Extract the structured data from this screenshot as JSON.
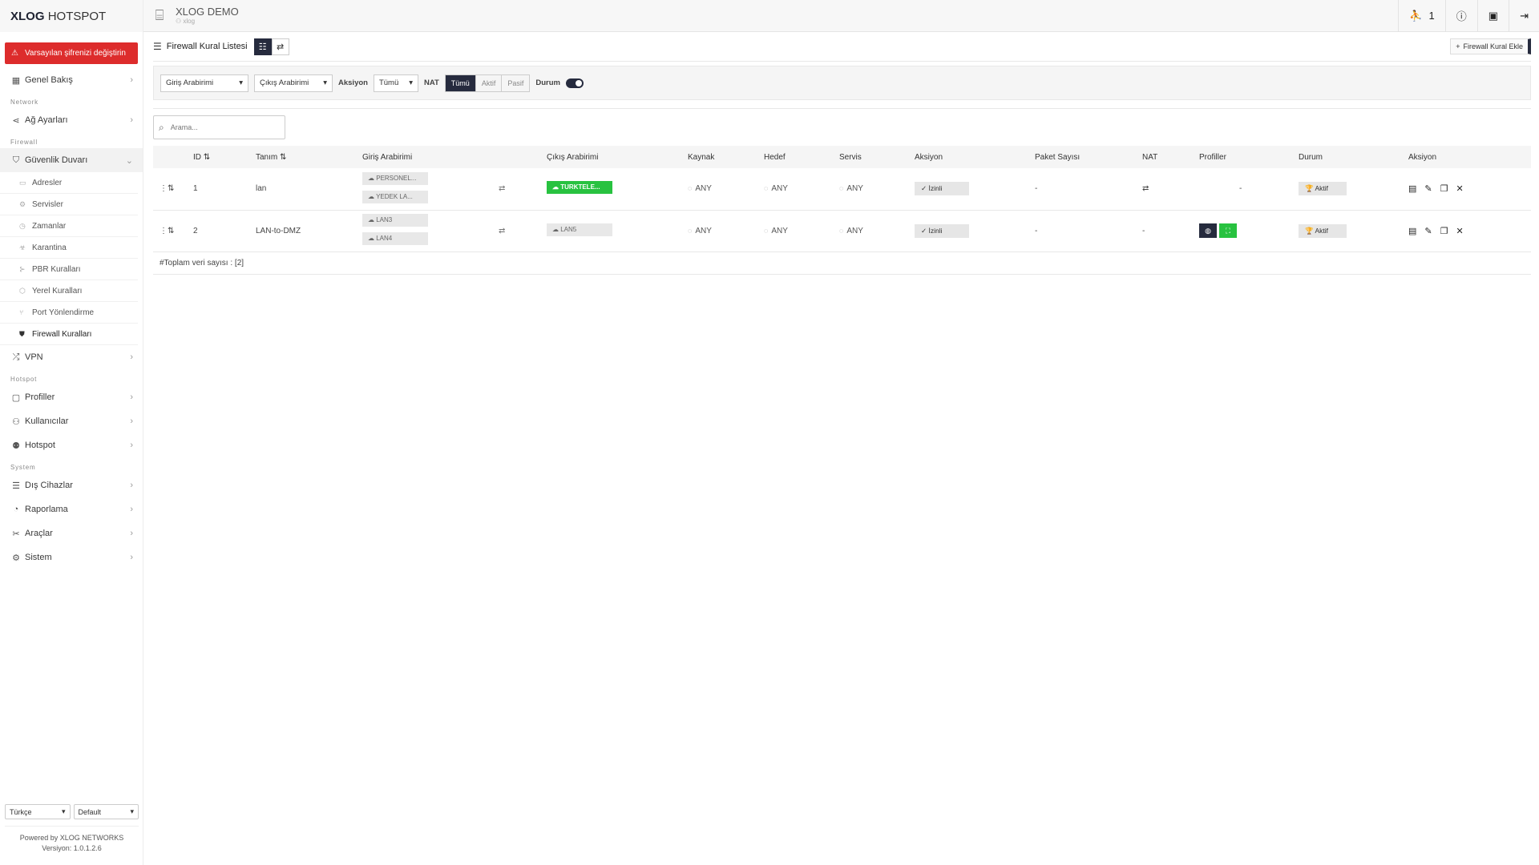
{
  "brand": {
    "bold": "XLOG",
    "light": "HOTSPOT"
  },
  "alert_text": "Varsayılan şifrenizi değiştirin",
  "menu": {
    "overview": "Genel Bakış",
    "network_section": "Network",
    "network": "Ağ Ayarları",
    "firewall_section": "Firewall",
    "security": "Güvenlik Duvarı",
    "sub": [
      "Adresler",
      "Servisler",
      "Zamanlar",
      "Karantina",
      "PBR Kuralları",
      "Yerel Kuralları",
      "Port Yönlendirme",
      "Firewall Kuralları"
    ],
    "vpn": "VPN",
    "hotspot_section": "Hotspot",
    "profiles": "Profiller",
    "users": "Kullanıcılar",
    "hotspot": "Hotspot",
    "system_section": "System",
    "devices": "Dış Cihazlar",
    "reports": "Raporlama",
    "tools": "Araçlar",
    "system": "Sistem"
  },
  "footer": {
    "language": "Türkçe",
    "theme": "Default",
    "powered": "Powered by XLOG NETWORKS",
    "version": "Versiyon: 1.0.1.2.6"
  },
  "topbar": {
    "title": "XLOG DEMO",
    "subtitle": "xlog",
    "online_count": "1"
  },
  "page": {
    "title": "Firewall Kural Listesi",
    "add_label": "Firewall Kural Ekle"
  },
  "filters": {
    "in_iface": "Giriş Arabirimi",
    "out_iface": "Çıkış Arabirimi",
    "action_label": "Aksiyon",
    "action_value": "Tümü",
    "nat_label": "NAT",
    "nat_options": [
      "Tümü",
      "Aktif",
      "Pasif"
    ],
    "status_label": "Durum"
  },
  "search": {
    "placeholder": "Arama..."
  },
  "table": {
    "headers": [
      "ID",
      "Tanım",
      "Giriş Arabirimi",
      "Çıkış Arabirimi",
      "Kaynak",
      "Hedef",
      "Servis",
      "Aksiyon",
      "Paket Sayısı",
      "NAT",
      "Profiller",
      "Durum",
      "Aksiyon"
    ],
    "rows": [
      {
        "id": "1",
        "name": "lan",
        "in": [
          "PERSONEL...",
          "YEDEK LA..."
        ],
        "out": "TURKTELE...",
        "src": "ANY",
        "dst": "ANY",
        "svc": "ANY",
        "action": "İzinli",
        "packets": "-",
        "nat": "⇄",
        "profiles": "-",
        "status": "Aktif"
      },
      {
        "id": "2",
        "name": "LAN-to-DMZ",
        "in": [
          "LAN3",
          "LAN4"
        ],
        "out": "LAN5",
        "src": "ANY",
        "dst": "ANY",
        "svc": "ANY",
        "action": "İzinli",
        "packets": "-",
        "nat": "-",
        "profiles": "",
        "status": "Aktif"
      }
    ],
    "total": "#Toplam veri sayısı : [2]"
  },
  "colors": {
    "accent": "#262b3e",
    "danger": "#dd2c2c",
    "success": "#28c240"
  }
}
